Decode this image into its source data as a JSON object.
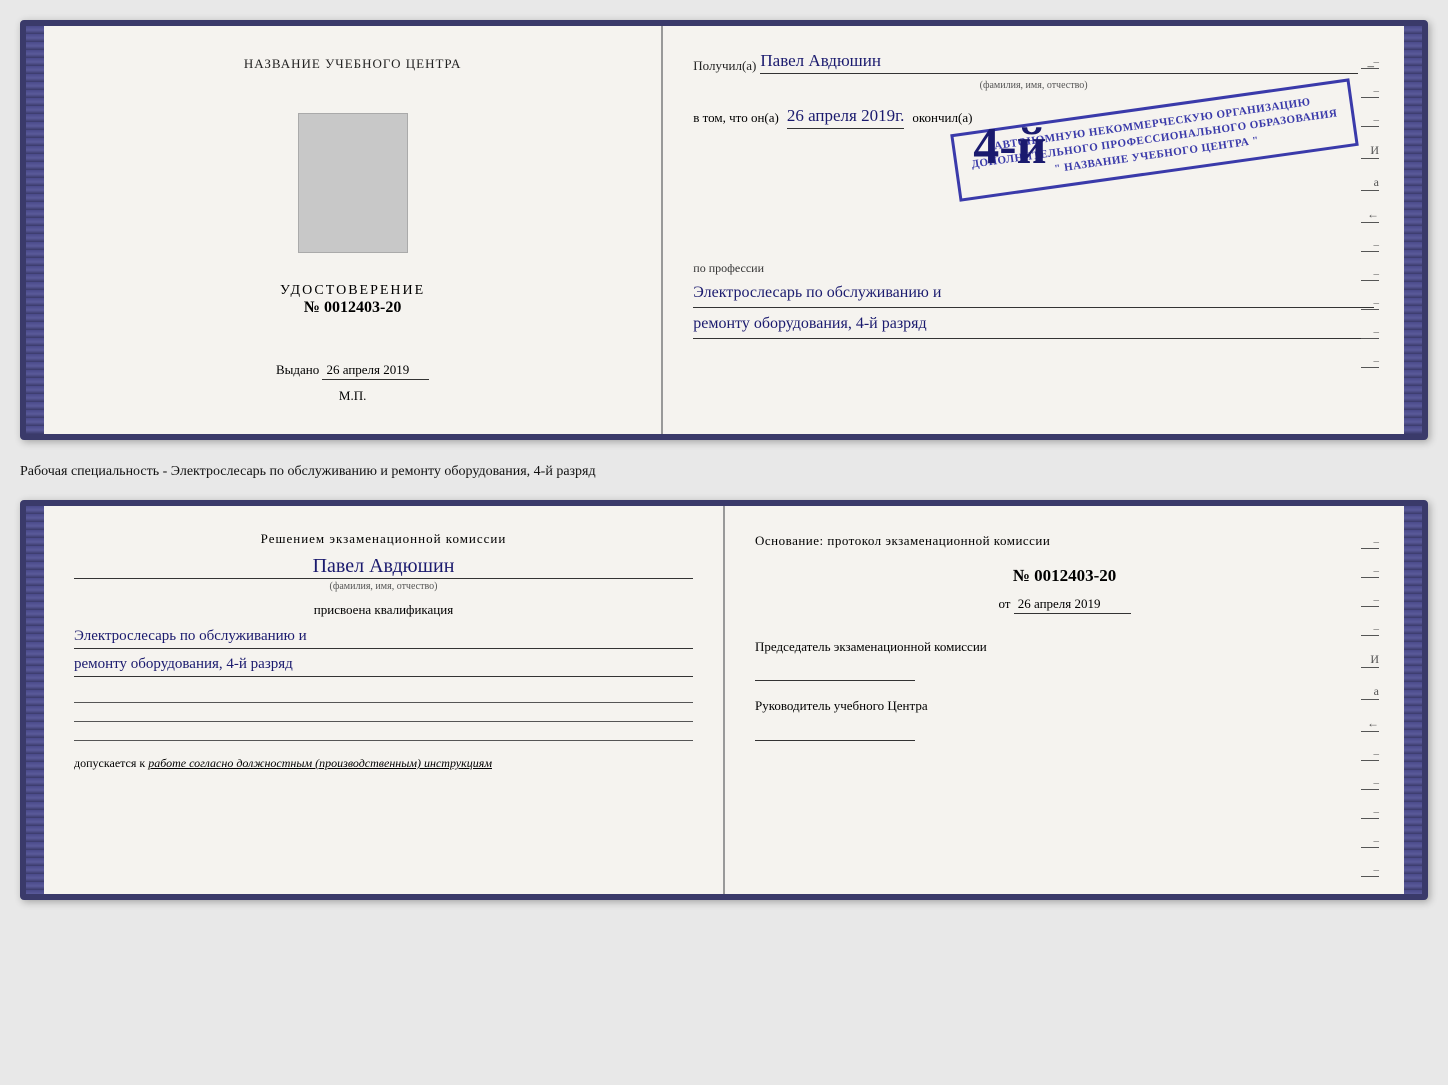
{
  "page": {
    "background": "#e8e8e8"
  },
  "top_booklet": {
    "left": {
      "training_center_label": "НАЗВАНИЕ УЧЕБНОГО ЦЕНТРА",
      "certificate_label": "УДОСТОВЕРЕНИЕ",
      "number_prefix": "№",
      "number": "0012403-20",
      "vydano_label": "Выдано",
      "vydano_date": "26 апреля 2019",
      "mp_label": "М.П."
    },
    "right": {
      "received_label": "Получил(а)",
      "name_value": "Павел Авдюшин",
      "name_hint": "(фамилия, имя, отчество)",
      "v_tom_chto_label": "в том, что он(а)",
      "date_value": "26 апреля 2019г.",
      "okonchil_label": "окончил(а)",
      "stamp_line1": "АВТОНОМНУЮ НЕКОММЕРЧЕСКУЮ ОРГАНИЗАЦИЮ",
      "stamp_line2": "ДОПОЛНИТЕЛЬНОГО ПРОФЕССИОНАЛЬНОГО ОБРАЗОВАНИЯ",
      "stamp_line3": "\" НАЗВАНИЕ УЧЕБНОГО ЦЕНТРА \"",
      "grade_badge": "4-й",
      "po_professii_label": "по профессии",
      "profession_line1": "Электрослесарь по обслуживанию и",
      "profession_line2": "ремонту оборудования, 4-й разряд"
    }
  },
  "separator": {
    "text": "Рабочая специальность - Электрослесарь по обслуживанию и ремонту оборудования, 4-й разряд"
  },
  "bottom_booklet": {
    "left": {
      "decision_label": "Решением экзаменационной комиссии",
      "name_value": "Павел Авдюшин",
      "name_hint": "(фамилия, имя, отчество)",
      "prisvoena_label": "присвоена квалификация",
      "kvalif_line1": "Электрослесарь по обслуживанию и",
      "kvalif_line2": "ремонту оборудования, 4-й разряд",
      "dopuskaetsya_label": "допускается к",
      "dopuskaetsya_value": "работе согласно должностным (производственным) инструкциям"
    },
    "right": {
      "osnование_label": "Основание: протокол экзаменационной комиссии",
      "number_prefix": "№",
      "number": "0012403-20",
      "ot_label": "от",
      "ot_date": "26 апреля 2019",
      "predsedatel_label": "Председатель экзаменационной комиссии",
      "rukovoditel_label": "Руководитель учебного Центра"
    }
  },
  "right_edge_chars": {
    "char1": "И",
    "char2": "а",
    "char3": "←"
  }
}
